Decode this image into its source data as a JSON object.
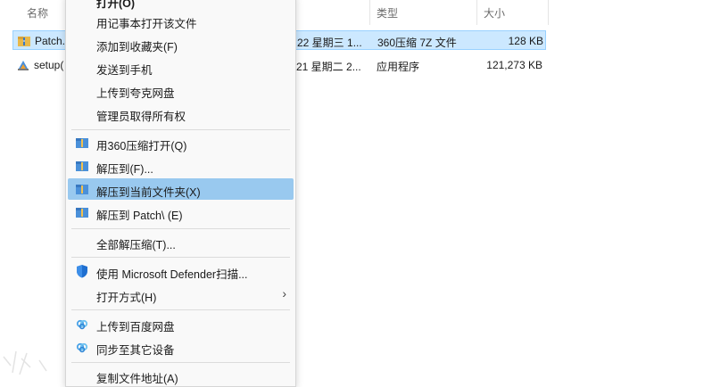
{
  "columns": {
    "name": "名称",
    "type": "类型",
    "size": "大小"
  },
  "files": [
    {
      "name": "Patch.",
      "date": "22 星期三 1...",
      "type": "360压缩 7Z 文件",
      "size": "128 KB",
      "icon": "archive-icon",
      "selected": true
    },
    {
      "name": "setup(",
      "date": "21 星期二 2...",
      "type": "应用程序",
      "size": "121,273 KB",
      "icon": "setup-exe-icon",
      "selected": false
    }
  ],
  "context_menu": {
    "top_item": "打开(O)",
    "group1": [
      "用记事本打开该文件",
      "添加到收藏夹(F)",
      "发送到手机",
      "上传到夸克网盘",
      "管理员取得所有权"
    ],
    "group2": [
      {
        "label": "用360压缩打开(Q)",
        "icon": "archive-360-icon"
      },
      {
        "label": "解压到(F)...",
        "icon": "archive-360-icon"
      },
      {
        "label": "解压到当前文件夹(X)",
        "icon": "archive-360-icon",
        "highlighted": true
      },
      {
        "label": "解压到 Patch\\ (E)",
        "icon": "archive-360-icon"
      }
    ],
    "group3": [
      "全部解压缩(T)..."
    ],
    "group4": [
      {
        "label": "使用 Microsoft Defender扫描...",
        "icon": "defender-shield-icon"
      },
      {
        "label": "打开方式(H)",
        "has_submenu": true
      }
    ],
    "group5": [
      {
        "label": "上传到百度网盘",
        "icon": "baidu-cloud-icon"
      },
      {
        "label": "同步至其它设备",
        "icon": "baidu-cloud-icon"
      }
    ],
    "bottom_item": "复制文件地址(A)"
  },
  "colors": {
    "selection_bg": "#cce8ff",
    "menu_highlight": "#99c9ef",
    "menu_bg": "#f9f9f9"
  }
}
